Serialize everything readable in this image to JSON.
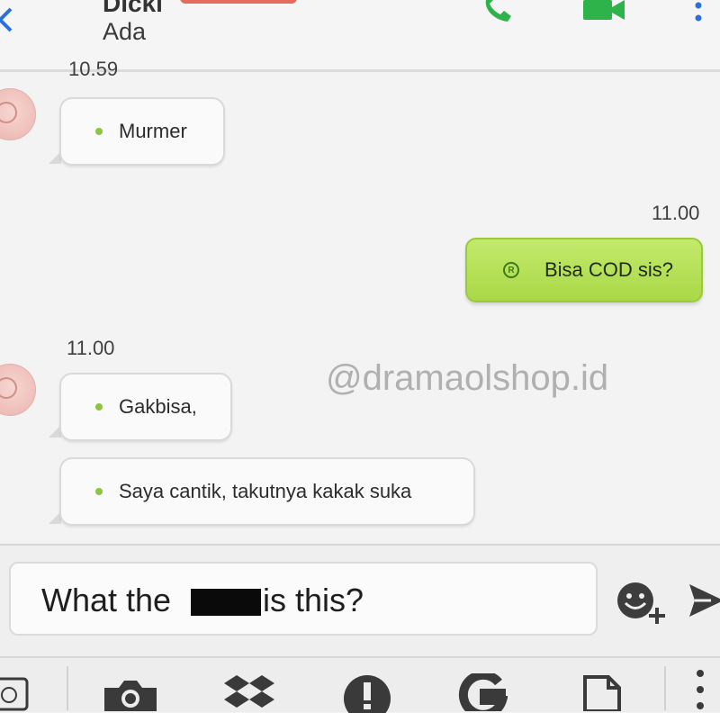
{
  "header": {
    "contact_name": "Dicki",
    "status": "Ada",
    "icons": [
      "back-arrow-icon",
      "phone-call-icon",
      "video-call-icon",
      "more-options-icon"
    ]
  },
  "messages": [
    {
      "direction": "incoming",
      "timestamp": "10.59",
      "text": "Murmer"
    },
    {
      "direction": "outgoing",
      "timestamp": "11.00",
      "text": "Bisa COD sis?",
      "read_mark": "R"
    },
    {
      "direction": "incoming",
      "timestamp": "11.00",
      "text": "Gakbisa,"
    },
    {
      "direction": "incoming",
      "timestamp": "",
      "text": "Saya cantik, takutnya kakak suka"
    }
  ],
  "watermark": "@dramaolshop.id",
  "composer": {
    "text_before": "What the ",
    "text_after": "is this?",
    "redacted": true
  },
  "toolbar": {
    "icons": [
      "history-icon",
      "camera-icon",
      "dropbox-icon",
      "alert-icon",
      "google-drive-icon",
      "document-icon",
      "more-options-icon"
    ]
  },
  "colors": {
    "outgoing_bubble": "#b5e05a",
    "incoming_dot": "#8cc63f",
    "call_green": "#2db34a"
  }
}
